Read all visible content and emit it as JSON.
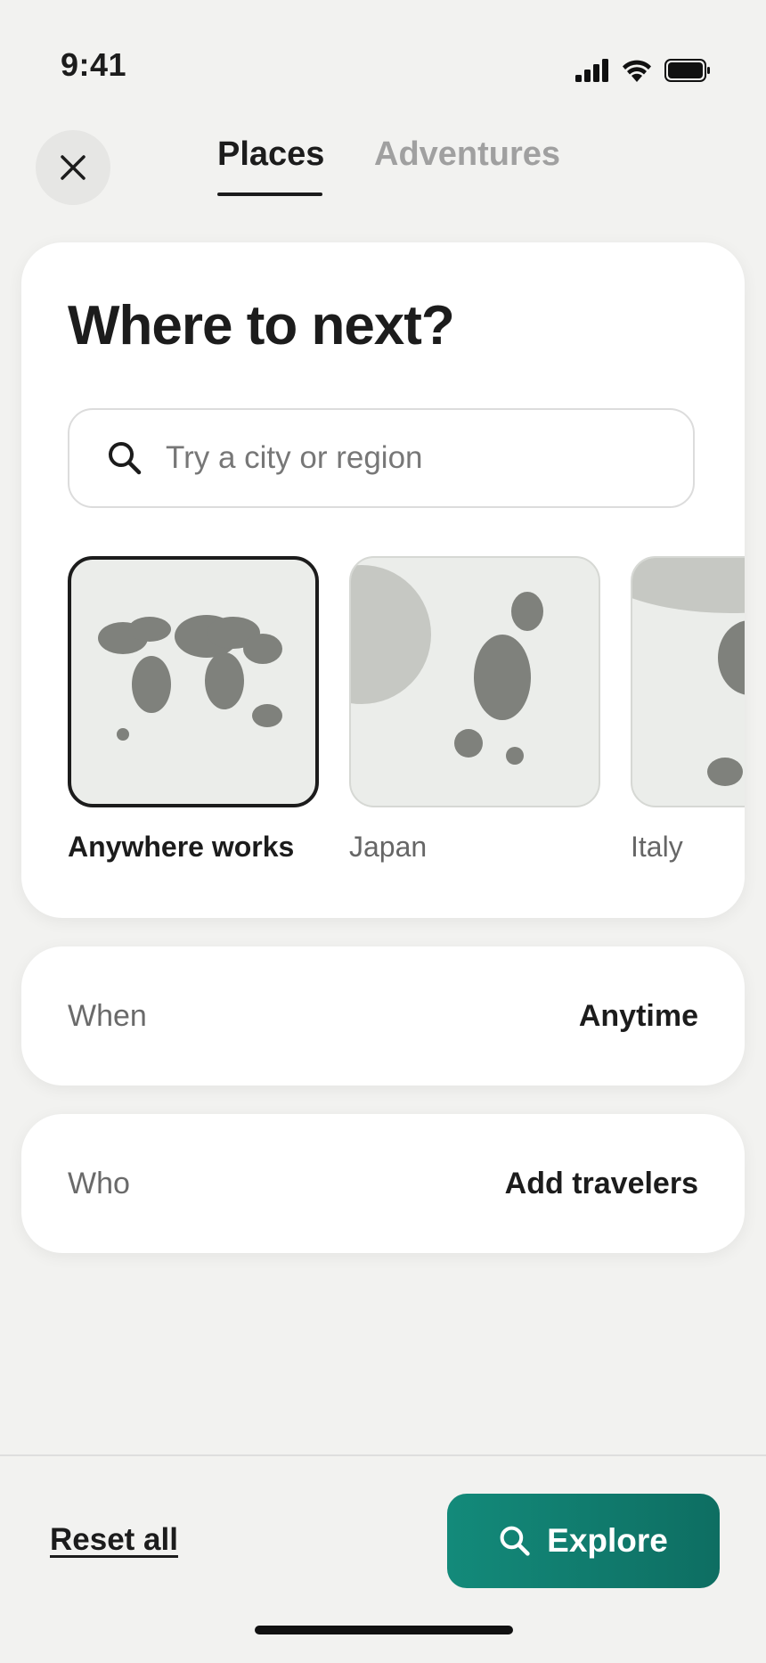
{
  "status_bar": {
    "time": "9:41"
  },
  "tabs": [
    {
      "label": "Places",
      "active": true
    },
    {
      "label": "Adventures",
      "active": false
    }
  ],
  "search_card": {
    "title": "Where to next?",
    "search_placeholder": "Try a city or region",
    "destinations": [
      {
        "label": "Anywhere works",
        "selected": true
      },
      {
        "label": "Japan",
        "selected": false
      },
      {
        "label": "Italy",
        "selected": false
      }
    ]
  },
  "when": {
    "label": "When",
    "value": "Anytime"
  },
  "who": {
    "label": "Who",
    "value": "Add travelers"
  },
  "footer": {
    "reset_label": "Reset all",
    "explore_label": "Explore"
  },
  "colors": {
    "accent": "#138a7a",
    "text": "#1c1c1c",
    "background": "#f2f2f0",
    "map_land": "#7f817c"
  }
}
